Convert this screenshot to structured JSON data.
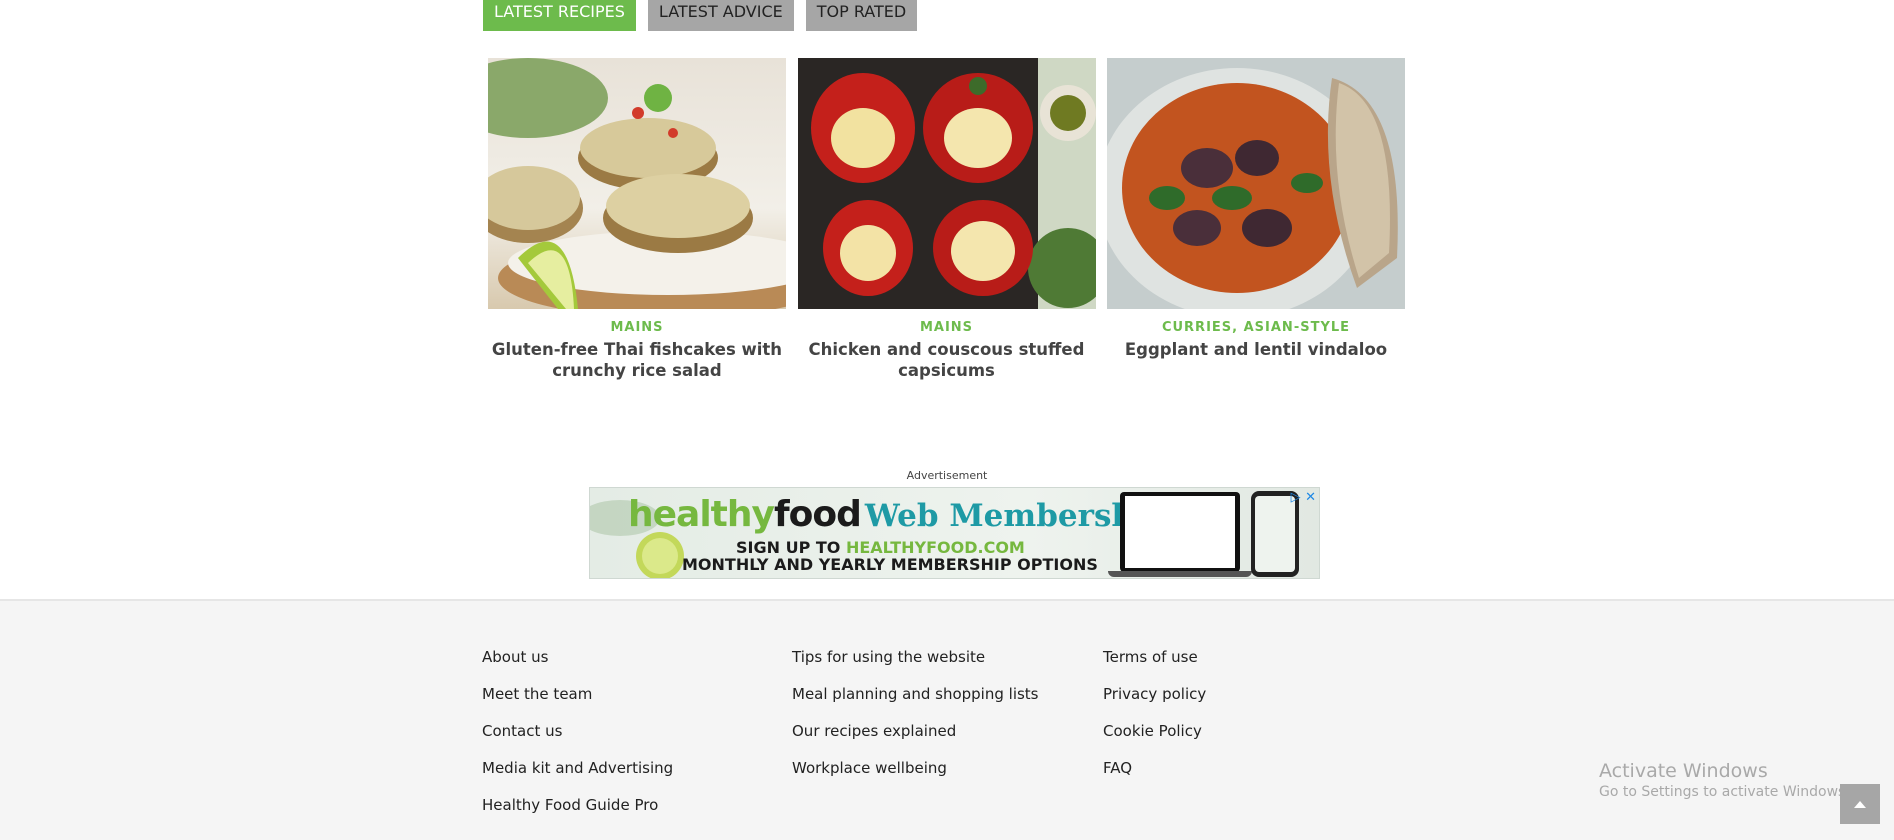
{
  "tabs": [
    {
      "label": "LATEST RECIPES",
      "active": true
    },
    {
      "label": "LATEST ADVICE",
      "active": false
    },
    {
      "label": "TOP RATED",
      "active": false
    }
  ],
  "cards": [
    {
      "category": "MAINS",
      "title": "Gluten-free Thai fishcakes with crunchy rice salad"
    },
    {
      "category": "MAINS",
      "title": "Chicken and couscous stuffed capsicums"
    },
    {
      "category": "CURRIES, ASIAN-STYLE",
      "title": "Eggplant and lentil vindaloo"
    }
  ],
  "ad": {
    "label": "Advertisement",
    "brand_healthy": "healthy",
    "brand_food": "food",
    "brand_membership": "Web Membership",
    "line1_prefix": "SIGN UP TO ",
    "line1_site": "HEALTHYFOOD.COM",
    "line2": "MONTHLY AND YEARLY MEMBERSHIP OPTIONS",
    "ad_choices": "▷ ✕"
  },
  "footer": {
    "col1": [
      "About us",
      "Meet the team",
      "Contact us",
      "Media kit and Advertising",
      "Healthy Food Guide Pro"
    ],
    "col2": [
      "Tips for using the website",
      "Meal planning and shopping lists",
      "Our recipes explained",
      "Workplace wellbeing"
    ],
    "col3": [
      "Terms of use",
      "Privacy policy",
      "Cookie Policy",
      "FAQ"
    ]
  },
  "watermark": {
    "title": "Activate Windows",
    "subtitle": "Go to Settings to activate Windows."
  },
  "colors": {
    "accent": "#6dbb4c",
    "tab_inactive": "#a6a6a6",
    "footer_bg": "#f5f5f5"
  }
}
